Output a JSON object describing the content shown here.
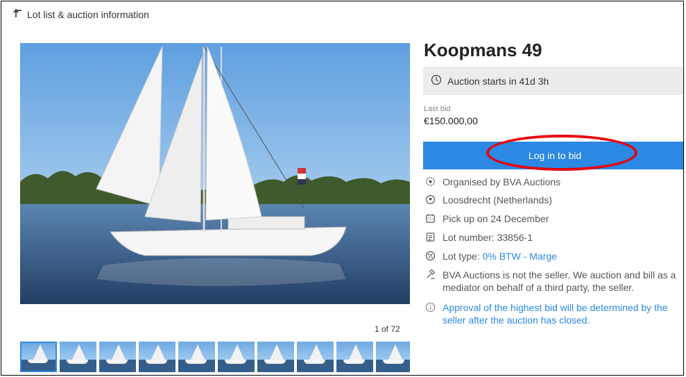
{
  "back": {
    "label": "Lot list & auction information"
  },
  "gallery": {
    "counter": "1 of 72"
  },
  "lot": {
    "title": "Koopmans 49",
    "auction_status": "Auction starts in 41d 3h",
    "last_bid_label": "Last bid",
    "last_bid_value": "€150.000,00",
    "login_button": "Log in to bid"
  },
  "details": {
    "organised": "Organised by BVA Auctions",
    "location": "Loosdrecht (Netherlands)",
    "pickup": "Pick up on 24 December",
    "lot_number": "Lot number: 33856-1",
    "lot_type_prefix": "Lot type: ",
    "lot_type_link": "0% BTW - Marge",
    "mediator": "BVA Auctions is not the seller. We auction and bill as a mediator on behalf of a third party, the seller.",
    "approval": "Approval of the highest bid will be determined by the seller after the auction has closed."
  },
  "colors": {
    "primary": "#2b88e3",
    "highlight_circle": "#e8000c",
    "status_bg": "#ececec"
  }
}
